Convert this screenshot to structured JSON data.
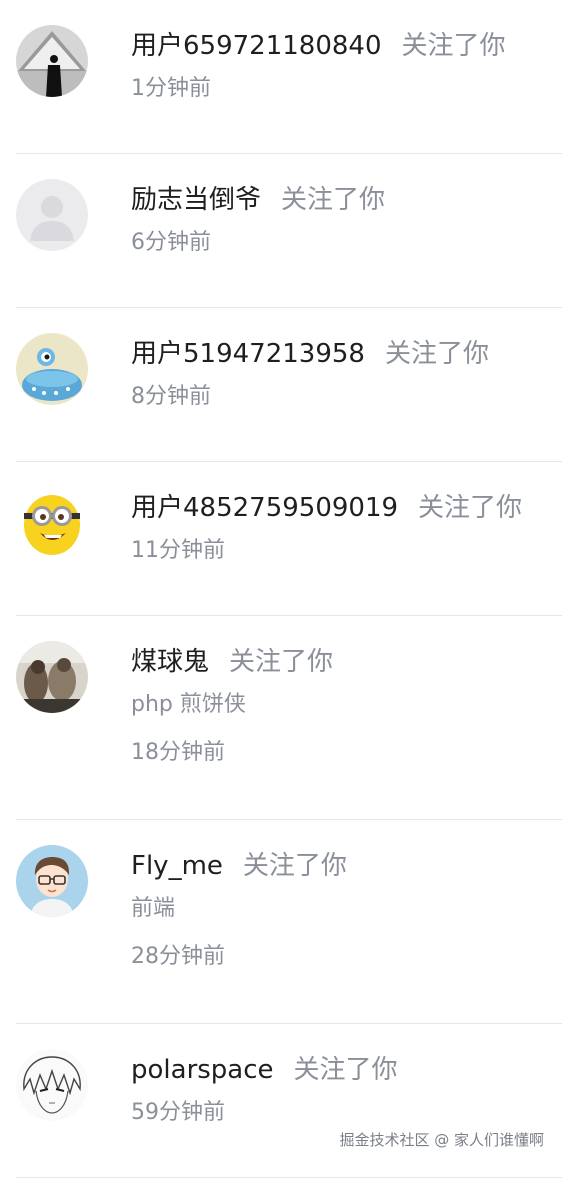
{
  "notifications": [
    {
      "username": "用户659721180840",
      "action": "关注了你",
      "time": "1分钟前",
      "avatar": "avatar-triangle-icon"
    },
    {
      "username": "励志当倒爷",
      "action": "关注了你",
      "time": "6分钟前",
      "avatar": "default-avatar-icon"
    },
    {
      "username": "用户51947213958",
      "action": "关注了你",
      "time": "8分钟前",
      "avatar": "robot-avatar-icon"
    },
    {
      "username": "用户4852759509019",
      "action": "关注了你",
      "time": "11分钟前",
      "avatar": "minion-avatar-icon"
    },
    {
      "username": "煤球鬼",
      "action": "关注了你",
      "bio": "php 煎饼侠",
      "time": "18分钟前",
      "avatar": "photo-avatar-icon"
    },
    {
      "username": "Fly_me",
      "action": "关注了你",
      "bio": "前端",
      "time": "28分钟前",
      "avatar": "glasses-boy-avatar-icon"
    },
    {
      "username": "polarspace",
      "action": "关注了你",
      "time": "59分钟前",
      "avatar": "anime-sketch-avatar-icon"
    }
  ],
  "watermark": "掘金技术社区 @ 家人们谁懂啊",
  "colors": {
    "primary_text": "#1f1f1f",
    "secondary_text": "#8a8f99",
    "divider": "#e6e6e6"
  }
}
